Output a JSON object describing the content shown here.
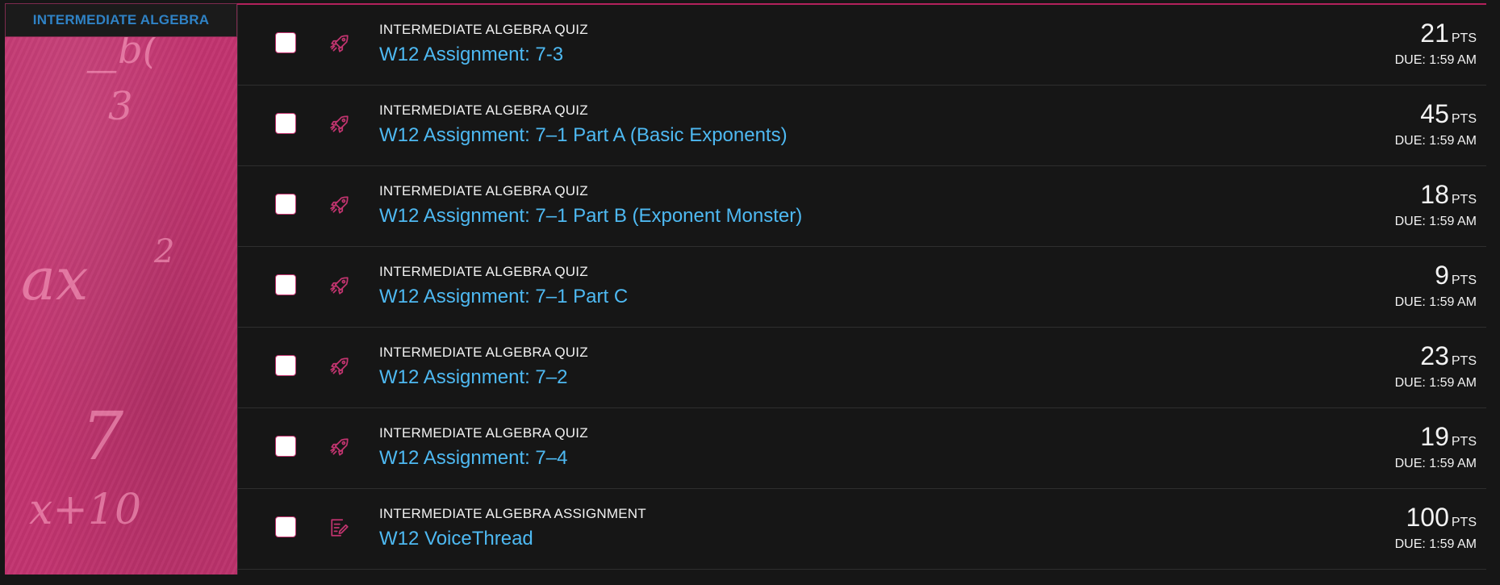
{
  "colors": {
    "background": "#161616",
    "course_accent": "#c2346f",
    "link": "#4eb9f2",
    "course_label": "#2f82c5"
  },
  "course": {
    "name": "INTERMEDIATE ALGEBRA"
  },
  "items": [
    {
      "type_label": "INTERMEDIATE ALGEBRA QUIZ",
      "title": "W12 Assignment: 7-3",
      "points": "21",
      "points_unit": "PTS",
      "due": "DUE: 1:59 AM",
      "icon": "rocket-icon"
    },
    {
      "type_label": "INTERMEDIATE ALGEBRA QUIZ",
      "title": "W12 Assignment: 7–1 Part A (Basic Exponents)",
      "points": "45",
      "points_unit": "PTS",
      "due": "DUE: 1:59 AM",
      "icon": "rocket-icon"
    },
    {
      "type_label": "INTERMEDIATE ALGEBRA QUIZ",
      "title": "W12 Assignment: 7–1 Part B (Exponent Monster)",
      "points": "18",
      "points_unit": "PTS",
      "due": "DUE: 1:59 AM",
      "icon": "rocket-icon"
    },
    {
      "type_label": "INTERMEDIATE ALGEBRA QUIZ",
      "title": "W12 Assignment: 7–1 Part C",
      "points": "9",
      "points_unit": "PTS",
      "due": "DUE: 1:59 AM",
      "icon": "rocket-icon"
    },
    {
      "type_label": "INTERMEDIATE ALGEBRA QUIZ",
      "title": "W12 Assignment: 7–2",
      "points": "23",
      "points_unit": "PTS",
      "due": "DUE: 1:59 AM",
      "icon": "rocket-icon"
    },
    {
      "type_label": "INTERMEDIATE ALGEBRA QUIZ",
      "title": "W12 Assignment: 7–4",
      "points": "19",
      "points_unit": "PTS",
      "due": "DUE: 1:59 AM",
      "icon": "rocket-icon"
    },
    {
      "type_label": "INTERMEDIATE ALGEBRA ASSIGNMENT",
      "title": "W12 VoiceThread",
      "points": "100",
      "points_unit": "PTS",
      "due": "DUE: 1:59 AM",
      "icon": "assignment-edit-icon"
    }
  ]
}
